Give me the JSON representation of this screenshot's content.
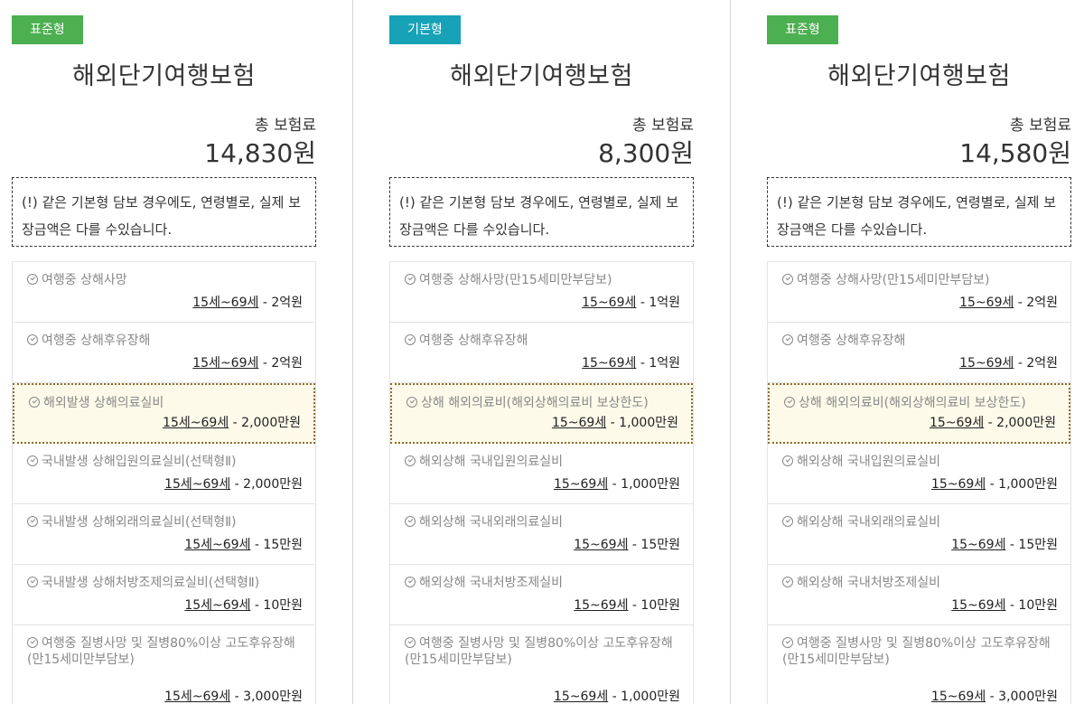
{
  "plans": [
    {
      "badge": "표준형",
      "badge_color": "#4caf50",
      "title": "해외단기여행보험",
      "total_label": "총 보험료",
      "total_value": "14,830원",
      "notice": "(!) 같은 기본형 담보 경우에도, 연령별로, 실제 보장금액은 다를 수있습니다.",
      "items": [
        {
          "label": "여행중 상해사망",
          "age": "15세~69세",
          "amount": " - 2억원"
        },
        {
          "label": "여행중 상해후유장해",
          "age": "15세~69세",
          "amount": " - 2억원"
        },
        {
          "label": "해외발생 상해의료실비",
          "age": "15세~69세",
          "amount": " - 2,000만원"
        },
        {
          "label": "국내발생 상해입원의료실비(선택형Ⅱ)",
          "age": "15세~69세",
          "amount": " - 2,000만원"
        },
        {
          "label": "국내발생 상해외래의료실비(선택형Ⅱ)",
          "age": "15세~69세",
          "amount": " - 15만원"
        },
        {
          "label": "국내발생 상해처방조제의료실비(선택형Ⅱ)",
          "age": "15세~69세",
          "amount": " - 10만원"
        },
        {
          "label": "여행중 질병사망 및 질병80%이상 고도후유장해(만15세미만부담보)",
          "age": "15세~69세",
          "amount": " - 3,000만원"
        }
      ]
    },
    {
      "badge": "기본형",
      "badge_color": "#17a2b8",
      "title": "해외단기여행보험",
      "total_label": "총 보험료",
      "total_value": "8,300원",
      "notice": "(!) 같은 기본형 담보 경우에도, 연령별로, 실제 보장금액은 다를 수있습니다.",
      "items": [
        {
          "label": "여행중 상해사망(만15세미만부담보)",
          "age": "15~69세",
          "amount": " - 1억원"
        },
        {
          "label": "여행중 상해후유장해",
          "age": "15~69세",
          "amount": " - 1억원"
        },
        {
          "label": "상해 해외의료비(해외상해의료비 보상한도)",
          "age": "15~69세",
          "amount": " - 1,000만원"
        },
        {
          "label": "해외상해 국내입원의료실비",
          "age": "15~69세",
          "amount": " - 1,000만원"
        },
        {
          "label": "해외상해 국내외래의료실비",
          "age": "15~69세",
          "amount": " - 15만원"
        },
        {
          "label": "해외상해 국내처방조제실비",
          "age": "15~69세",
          "amount": " - 10만원"
        },
        {
          "label": "여행중 질병사망 및 질병80%이상 고도후유장해(만15세미만부담보)",
          "age": "15~69세",
          "amount": " - 1,000만원"
        }
      ]
    },
    {
      "badge": "표준형",
      "badge_color": "#4caf50",
      "title": "해외단기여행보험",
      "total_label": "총 보험료",
      "total_value": "14,580원",
      "notice": "(!) 같은 기본형 담보 경우에도, 연령별로, 실제 보장금액은 다를 수있습니다.",
      "items": [
        {
          "label": "여행중 상해사망(만15세미만부담보)",
          "age": "15~69세",
          "amount": " - 2억원"
        },
        {
          "label": "여행중 상해후유장해",
          "age": "15~69세",
          "amount": " - 2억원"
        },
        {
          "label": "상해 해외의료비(해외상해의료비 보상한도)",
          "age": "15~69세",
          "amount": " - 2,000만원"
        },
        {
          "label": "해외상해 국내입원의료실비",
          "age": "15~69세",
          "amount": " - 1,000만원"
        },
        {
          "label": "해외상해 국내외래의료실비",
          "age": "15~69세",
          "amount": " - 15만원"
        },
        {
          "label": "해외상해 국내처방조제실비",
          "age": "15~69세",
          "amount": " - 10만원"
        },
        {
          "label": "여행중 질병사망 및 질병80%이상 고도후유장해(만15세미만부담보)",
          "age": "15~69세",
          "amount": " - 3,000만원"
        }
      ]
    }
  ]
}
